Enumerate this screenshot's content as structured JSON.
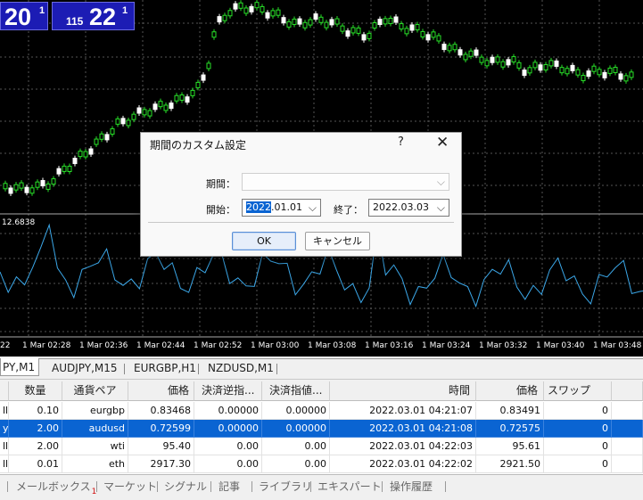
{
  "quote_bid": {
    "big": "20",
    "sup": "1"
  },
  "quote_ask": {
    "small": "115",
    "big": "22",
    "sup": "1"
  },
  "indicator_label": "12.6838",
  "time_axis": [
    "22",
    "1 Mar 02:28",
    "1 Mar 02:36",
    "1 Mar 02:44",
    "1 Mar 02:52",
    "1 Mar 03:00",
    "1 Mar 03:08",
    "1 Mar 03:16",
    "1 Mar 03:24",
    "1 Mar 03:32",
    "1 Mar 03:40",
    "1 Mar 03:48"
  ],
  "chart_tabs": [
    "PY,M1",
    "AUDJPY,M15",
    "EURGBP,H1",
    "NZDUSD,M1"
  ],
  "table": {
    "headers": [
      "",
      "数量",
      "通貨ペア",
      "価格",
      "決済逆指...",
      "決済指値...",
      "時間",
      "価格",
      "スワップ"
    ],
    "rows": [
      [
        "ll",
        "0.10",
        "eurgbp",
        "0.83468",
        "0.00000",
        "0.00000",
        "2022.03.01 04:21:07",
        "0.83491",
        "0"
      ],
      [
        "y",
        "2.00",
        "audusd",
        "0.72599",
        "0.00000",
        "0.00000",
        "2022.03.01 04:21:08",
        "0.72575",
        "0"
      ],
      [
        "ll",
        "2.00",
        "wti",
        "95.40",
        "0.00",
        "0.00",
        "2022.03.01 04:22:03",
        "95.61",
        "0"
      ],
      [
        "ll",
        "0.01",
        "eth",
        "2917.30",
        "0.00",
        "0.00",
        "2022.03.01 04:22:02",
        "2921.50",
        "0"
      ]
    ],
    "selected_row": 1
  },
  "bottom_tabs": {
    "mailbox": "メールボックス",
    "mailbox_badge": "1",
    "items": [
      "マーケット",
      "シグナル",
      "記事",
      "ライブラリ",
      "エキスパート",
      "操作履歴"
    ]
  },
  "dialog": {
    "title": "期間のカスタム設定",
    "help": "?",
    "close": "✕",
    "period_label": "期間：",
    "period_value": "",
    "start_label": "開始：",
    "start_sel": "2022",
    "start_rest": ".01.01",
    "end_label": "終了：",
    "end_value": "2022.03.03",
    "ok": "OK",
    "cancel": "キャンセル"
  },
  "colors": {
    "bull": "#28e028",
    "bear": "#ffffff",
    "indicator": "#3ba7e8",
    "grid": "#555555"
  }
}
